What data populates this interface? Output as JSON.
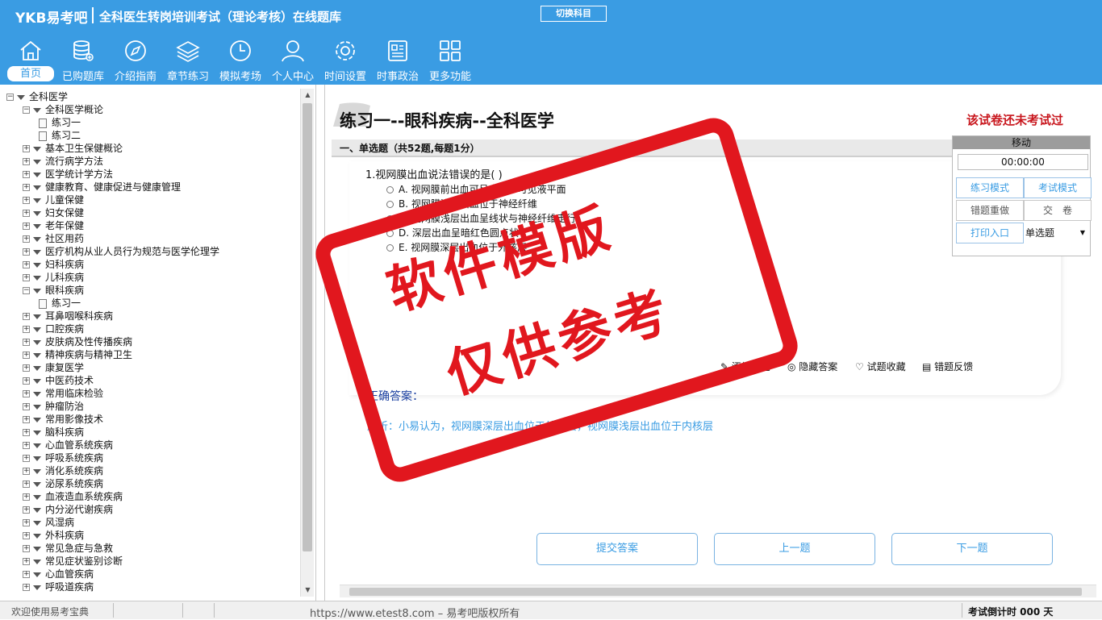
{
  "header": {
    "logo": "YKB易考吧",
    "title": "全科医生转岗培训考试（理论考核）在线题库",
    "switch_label": "切换科目"
  },
  "nav": [
    {
      "label": "首页",
      "icon": "home-icon"
    },
    {
      "label": "已购题库",
      "icon": "database-icon"
    },
    {
      "label": "介绍指南",
      "icon": "compass-icon"
    },
    {
      "label": "章节练习",
      "icon": "layers-icon"
    },
    {
      "label": "模拟考场",
      "icon": "clock-icon"
    },
    {
      "label": "个人中心",
      "icon": "user-icon"
    },
    {
      "label": "时间设置",
      "icon": "gear-icon"
    },
    {
      "label": "时事政治",
      "icon": "news-icon"
    },
    {
      "label": "更多功能",
      "icon": "grid-icon"
    }
  ],
  "tree": [
    {
      "label": "全科医学",
      "level": 0,
      "sign": "-"
    },
    {
      "label": "全科医学概论",
      "level": 1,
      "sign": "-"
    },
    {
      "label": "练习一",
      "level": 2,
      "sign": ""
    },
    {
      "label": "练习二",
      "level": 2,
      "sign": ""
    },
    {
      "label": "基本卫生保健概论",
      "level": 1,
      "sign": "+"
    },
    {
      "label": "流行病学方法",
      "level": 1,
      "sign": "+"
    },
    {
      "label": "医学统计学方法",
      "level": 1,
      "sign": "+"
    },
    {
      "label": "健康教育、健康促进与健康管理",
      "level": 1,
      "sign": "+"
    },
    {
      "label": "儿童保健",
      "level": 1,
      "sign": "+"
    },
    {
      "label": "妇女保健",
      "level": 1,
      "sign": "+"
    },
    {
      "label": "老年保健",
      "level": 1,
      "sign": "+"
    },
    {
      "label": "社区用药",
      "level": 1,
      "sign": "+"
    },
    {
      "label": "医疗机构从业人员行为规范与医学伦理学",
      "level": 1,
      "sign": "+"
    },
    {
      "label": "妇科疾病",
      "level": 1,
      "sign": "+"
    },
    {
      "label": "儿科疾病",
      "level": 1,
      "sign": "+"
    },
    {
      "label": "眼科疾病",
      "level": 1,
      "sign": "-"
    },
    {
      "label": "练习一",
      "level": 2,
      "sign": ""
    },
    {
      "label": "耳鼻咽喉科疾病",
      "level": 1,
      "sign": "+"
    },
    {
      "label": "口腔疾病",
      "level": 1,
      "sign": "+"
    },
    {
      "label": "皮肤病及性传播疾病",
      "level": 1,
      "sign": "+"
    },
    {
      "label": "精神疾病与精神卫生",
      "level": 1,
      "sign": "+"
    },
    {
      "label": "康复医学",
      "level": 1,
      "sign": "+"
    },
    {
      "label": "中医药技术",
      "level": 1,
      "sign": "+"
    },
    {
      "label": "常用临床检验",
      "level": 1,
      "sign": "+"
    },
    {
      "label": "肿瘤防治",
      "level": 1,
      "sign": "+"
    },
    {
      "label": "常用影像技术",
      "level": 1,
      "sign": "+"
    },
    {
      "label": "脑科疾病",
      "level": 1,
      "sign": "+"
    },
    {
      "label": "心血管系统疾病",
      "level": 1,
      "sign": "+"
    },
    {
      "label": "呼吸系统疾病",
      "level": 1,
      "sign": "+"
    },
    {
      "label": "消化系统疾病",
      "level": 1,
      "sign": "+"
    },
    {
      "label": "泌尿系统疾病",
      "level": 1,
      "sign": "+"
    },
    {
      "label": "血液造血系统疾病",
      "level": 1,
      "sign": "+"
    },
    {
      "label": "内分泌代谢疾病",
      "level": 1,
      "sign": "+"
    },
    {
      "label": "风湿病",
      "level": 1,
      "sign": "+"
    },
    {
      "label": "外科疾病",
      "level": 1,
      "sign": "+"
    },
    {
      "label": "常见急症与急救",
      "level": 1,
      "sign": "+"
    },
    {
      "label": "常见症状鉴别诊断",
      "level": 1,
      "sign": "+"
    },
    {
      "label": "心血管疾病",
      "level": 1,
      "sign": "+"
    },
    {
      "label": "呼吸道疾病",
      "level": 1,
      "sign": "+"
    }
  ],
  "main": {
    "paper_title": "练习一--眼科疾病--全科医学",
    "status": "该试卷还未考试过",
    "section": "一、单选题（共52题,每题1分）",
    "question": "1.视网膜出血说法错误的是( )",
    "options": [
      "A. 视网膜前出血可呈舟状，可见液平面",
      "B. 视网膜浅层出血位于神经纤维",
      "C. 视网膜浅层出血呈线状与神经纤维走行",
      "D. 深层出血呈暗红色圆点状",
      "E. 视网膜深层出血位于外核层"
    ],
    "tools": [
      "添加笔记",
      "隐藏答案",
      "试题收藏",
      "错题反馈"
    ],
    "answer_label": "正确答案：",
    "analysis": "解析：小易认为，视网膜深层出血位于外核层，视网膜浅层出血位于内核层",
    "buttons": {
      "submit": "提交答案",
      "prev": "上一题",
      "next": "下一题"
    }
  },
  "panel": {
    "move_label": "移动",
    "timer": "00:00:00",
    "practice_mode": "练习模式",
    "exam_mode": "考试模式",
    "redo": "错题重做",
    "handin": "交　卷",
    "print": "打印入口",
    "type_select": "单选题"
  },
  "status": {
    "welcome": "欢迎使用易考宝典",
    "site": "https://www.etest8.com – 易考吧版权所有",
    "countdown": "考试倒计时 000 天"
  },
  "stamp": {
    "line1": "软件模版",
    "line2": "仅供参考"
  }
}
